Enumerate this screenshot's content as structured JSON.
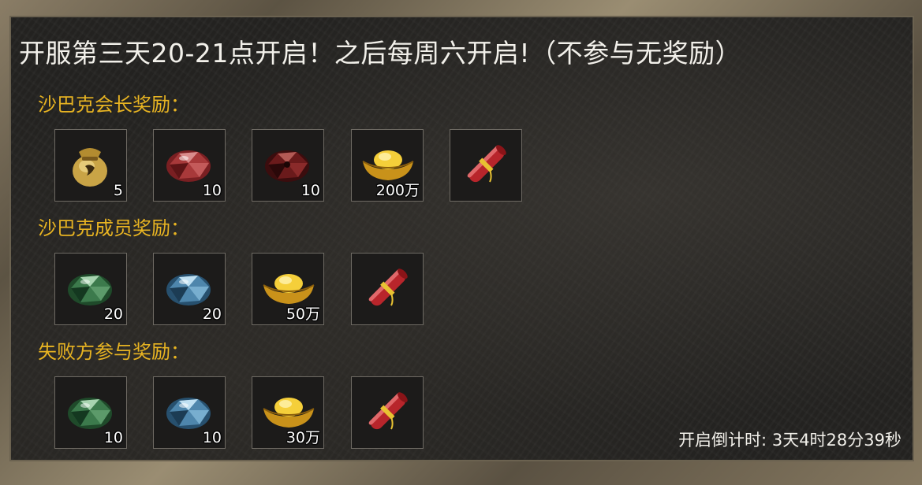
{
  "title": "开服第三天20-21点开启！之后每周六开启!（不参与无奖励）",
  "sections": [
    {
      "label": "沙巴克会长奖励：",
      "items": [
        {
          "icon": "gold-pouch-icon",
          "qty": "5"
        },
        {
          "icon": "red-gem-icon",
          "qty": "10"
        },
        {
          "icon": "dark-red-gem-icon",
          "qty": "10"
        },
        {
          "icon": "gold-ingot-icon",
          "qty": "200万"
        },
        {
          "icon": "scroll-icon",
          "qty": ""
        }
      ]
    },
    {
      "label": "沙巴克成员奖励：",
      "items": [
        {
          "icon": "green-gem-icon",
          "qty": "20"
        },
        {
          "icon": "blue-gem-icon",
          "qty": "20"
        },
        {
          "icon": "gold-ingot-icon",
          "qty": "50万"
        },
        {
          "icon": "scroll-icon",
          "qty": ""
        }
      ]
    },
    {
      "label": "失败方参与奖励：",
      "items": [
        {
          "icon": "green-gem-icon",
          "qty": "10"
        },
        {
          "icon": "blue-gem-icon",
          "qty": "10"
        },
        {
          "icon": "gold-ingot-icon",
          "qty": "30万"
        },
        {
          "icon": "scroll-icon",
          "qty": ""
        }
      ]
    }
  ],
  "countdown": {
    "label": "开启倒计时:",
    "value": "3天4时28分39秒"
  },
  "colors": {
    "section_label": "#e8b422",
    "title": "#f2f0ea",
    "panel_bg": "#252422"
  }
}
